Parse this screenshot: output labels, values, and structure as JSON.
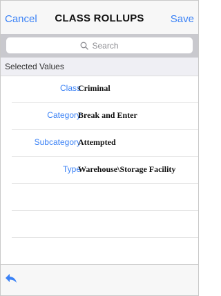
{
  "nav": {
    "cancel_label": "Cancel",
    "title": "CLASS ROLLUPS",
    "save_label": "Save"
  },
  "search": {
    "placeholder": "Search"
  },
  "section": {
    "title": "Selected Values"
  },
  "rows": [
    {
      "label": "Class",
      "value": "Criminal"
    },
    {
      "label": "Category",
      "value": "Break and Enter"
    },
    {
      "label": "Subcategory",
      "value": "Attempted"
    },
    {
      "label": "Type",
      "value": "Warehouse\\Storage Facility"
    }
  ],
  "toolbar": {
    "back_icon": "back-arrow-icon"
  },
  "colors": {
    "accent": "#3b82f6",
    "searchbar_bg": "#c9c9ce",
    "section_bg": "#efeff4"
  }
}
